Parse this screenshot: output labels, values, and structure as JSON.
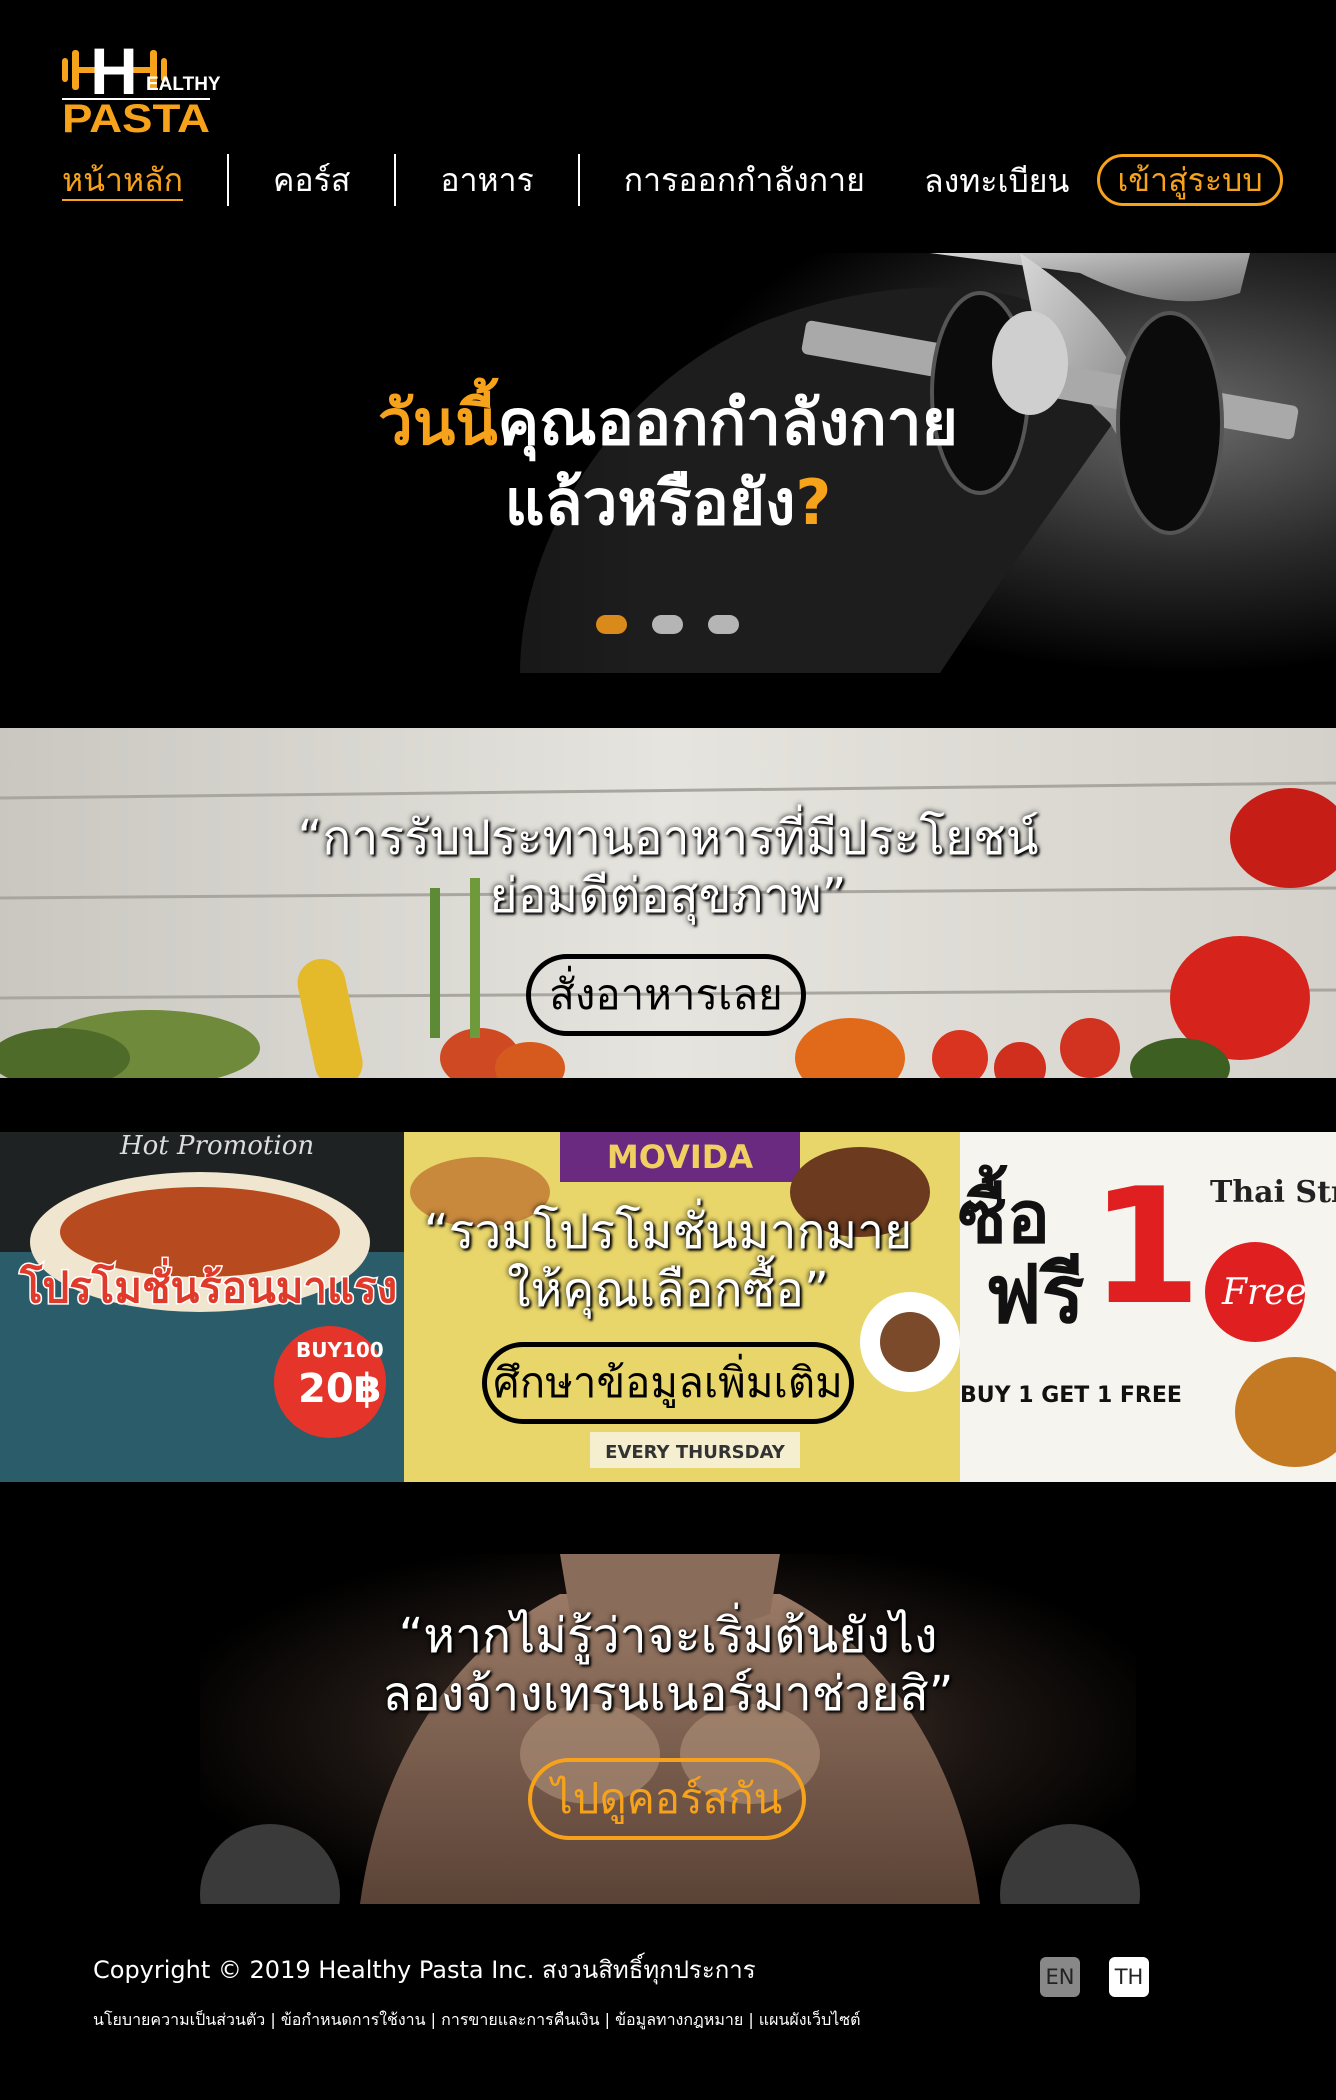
{
  "brand": {
    "logo_letter": "H",
    "logo_top": "EALTHY",
    "logo_bottom": "PASTA",
    "accent_color": "#f7a21b"
  },
  "nav": {
    "items": [
      {
        "label": "หน้าหลัก",
        "active": true
      },
      {
        "label": "คอร์ส"
      },
      {
        "label": "อาหาร"
      },
      {
        "label": "การออกกำลังกาย"
      }
    ],
    "register_label": "ลงทะเบียน",
    "login_label": "เข้าสู่ระบบ"
  },
  "hero": {
    "line1_accent": "วันนี้",
    "line1_rest": "คุณออกกำลังกาย",
    "line2_main": "แล้วหรือยัง",
    "line2_accent": "?",
    "slide_count": 3,
    "active_slide": 1
  },
  "banners": {
    "food": {
      "line1": "“การรับประทานอาหารที่มีประโยชน์",
      "line2": "ย่อมดีต่อสุขภาพ”",
      "button": "สั่งอาหารเลย"
    },
    "promo": {
      "line1": "“รวมโปรโมชั่นมากมาย",
      "line2": "ให้คุณเลือกซื้อ”",
      "button": "ศึกษาข้อมูลเพิ่มเติม",
      "bg_text_left_top": "Hot Promotion",
      "bg_text_left_main": "โปรโมชั่นร้อนมาแรง",
      "bg_text_left_price": "20฿",
      "bg_text_left_buy": "BUY100",
      "bg_text_mid_top": "MOVIDA",
      "bg_text_mid_bottom": "EVERY THURSDAY",
      "bg_text_right_buy": "ซื้อ",
      "bg_text_right_free": "ฟรี",
      "bg_text_right_one": "1",
      "bg_text_right_brand": "Thai Str",
      "bg_text_right_offer": "BUY 1 GET 1 FREE",
      "bg_text_right_badge": "Free"
    },
    "trainer": {
      "line1": "“หากไม่รู้ว่าจะเริ่มต้นยังไง",
      "line2": "ลองจ้างเทรนเนอร์มาช่วยสิ”",
      "button": "ไปดูคอร์สกัน"
    }
  },
  "footer": {
    "copyright": "Copyright © 2019 Healthy Pasta Inc. สงวนสิทธิ์ทุกประการ",
    "links": "นโยบายความเป็นส่วนตัว | ข้อกำหนดการใช้งาน | การขายและการคืนเงิน | ข้อมูลทางกฎหมาย | แผนผังเว็บไซต์",
    "lang_en": "EN",
    "lang_th": "TH"
  }
}
